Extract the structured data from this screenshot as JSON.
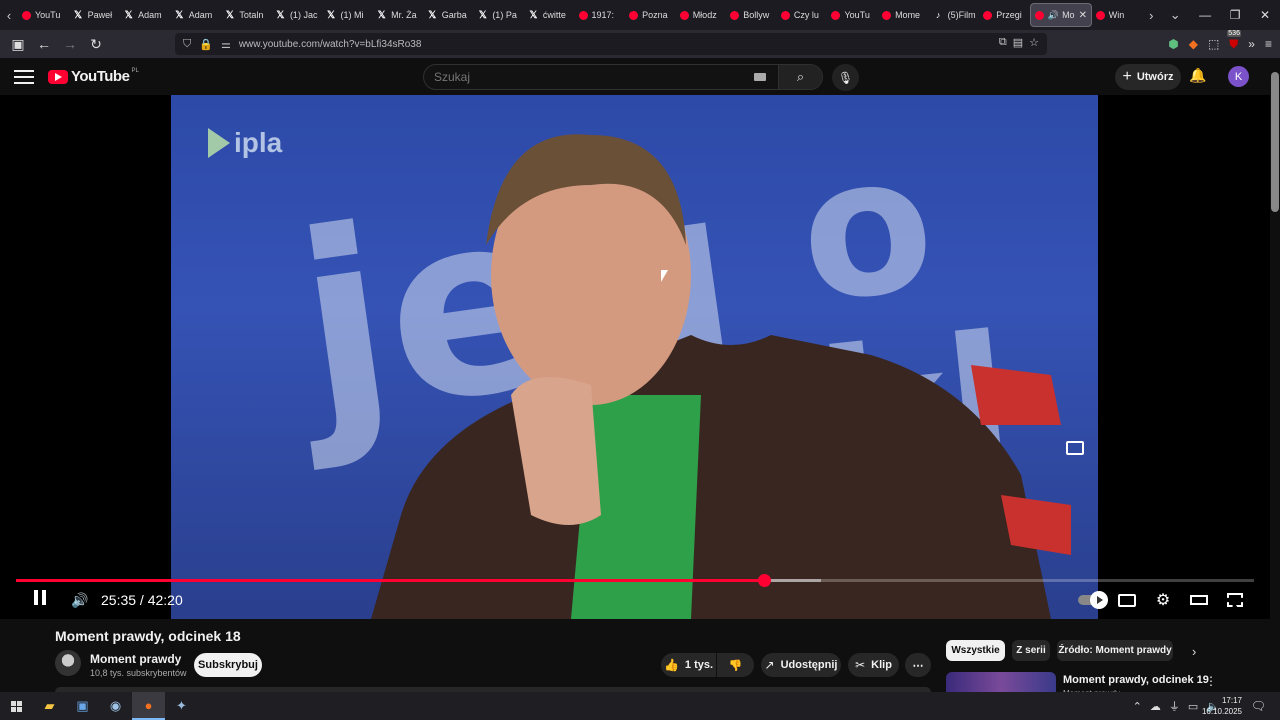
{
  "browser": {
    "tabs": [
      {
        "label": "YouTu",
        "icon": "youtube-icon"
      },
      {
        "label": "Paweł",
        "icon": "x-icon"
      },
      {
        "label": "Adam",
        "icon": "x-icon"
      },
      {
        "label": "Adam",
        "icon": "x-icon"
      },
      {
        "label": "Totaln",
        "icon": "x-icon"
      },
      {
        "label": "(1) Jac",
        "icon": "x-icon"
      },
      {
        "label": "(1) Mi",
        "icon": "x-icon"
      },
      {
        "label": "Mr. Ża",
        "icon": "x-icon"
      },
      {
        "label": "Garba",
        "icon": "x-icon"
      },
      {
        "label": "(1) Pa",
        "icon": "x-icon"
      },
      {
        "label": "ćwitte",
        "icon": "x-icon"
      },
      {
        "label": "1917:",
        "icon": "youtube-icon"
      },
      {
        "label": "Pozna",
        "icon": "youtube-icon"
      },
      {
        "label": "Młodz",
        "icon": "youtube-icon"
      },
      {
        "label": "Bollyw",
        "icon": "youtube-icon"
      },
      {
        "label": "Czy lu",
        "icon": "youtube-icon"
      },
      {
        "label": "YouTu",
        "icon": "youtube-icon"
      },
      {
        "label": "Mome",
        "icon": "youtube-icon"
      },
      {
        "label": "(5)Film",
        "icon": "tiktok-icon"
      },
      {
        "label": "Przegi",
        "icon": "youtube-icon"
      }
    ],
    "active_tab": {
      "label": "Mo"
    },
    "after_tab": {
      "label": "Win"
    },
    "url": "www.youtube.com/watch?v=bLfi34sRo38",
    "ext_badge": "536"
  },
  "yt": {
    "logo_text": "YouTube",
    "country": "PL",
    "search_placeholder": "Szukaj",
    "create_label": "Utwórz",
    "avatar_letter": "K"
  },
  "player": {
    "channel_logo": "ipla",
    "time_current": "25:35",
    "time_total": "42:20",
    "time_display": "25:35 / 42:20",
    "played_fraction": 0.604,
    "buffered_fraction": 0.65
  },
  "video": {
    "title": "Moment prawdy, odcinek 18",
    "channel": "Moment prawdy",
    "subscribers": "10,8 tys. subskrybentów",
    "subscribe_label": "Subskrybuj",
    "likes": "1 tys.",
    "share_label": "Udostępnij",
    "clip_label": "Klip"
  },
  "sidebar": {
    "chips": [
      "Wszystkie",
      "Z serii",
      "Źródło: Moment prawdy"
    ],
    "rec_title": "Moment prawdy, odcinek 19",
    "rec_channel": "Moment prawdy"
  },
  "taskbar": {
    "time": "17:17",
    "date": "16.10.2025"
  },
  "colors": {
    "accent": "#ff0033",
    "background": "#0f0f0f"
  }
}
